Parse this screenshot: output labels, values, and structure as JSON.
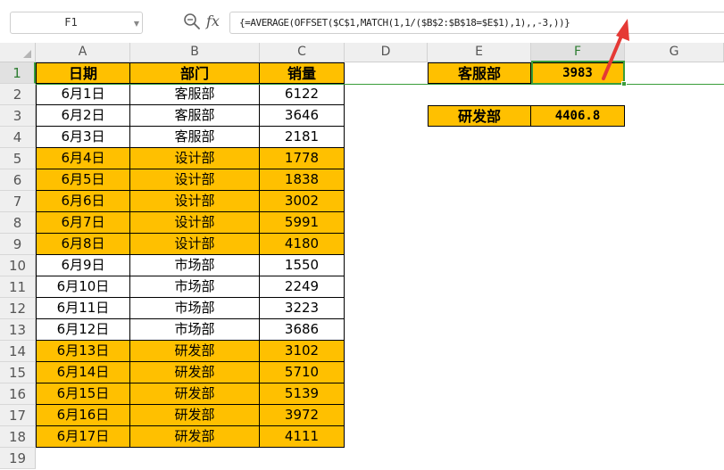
{
  "formula_bar": {
    "name_box": "F1",
    "formula": "{=AVERAGE(OFFSET($C$1,MATCH(1,1/($B$2:$B$18=$E$1),1),,-3,))}",
    "zoom_icon": "zoom-search-icon",
    "fx_label": "fx"
  },
  "columns": [
    "A",
    "B",
    "C",
    "D",
    "E",
    "F",
    "G"
  ],
  "active_column": "F",
  "active_row": "1",
  "rows": [
    "1",
    "2",
    "3",
    "4",
    "5",
    "6",
    "7",
    "8",
    "9",
    "10",
    "11",
    "12",
    "13",
    "14",
    "15",
    "16",
    "17",
    "18",
    "19"
  ],
  "table": {
    "headers": [
      "日期",
      "部门",
      "销量"
    ],
    "data": [
      {
        "date": "6月1日",
        "dept": "客服部",
        "sales": "6122",
        "highlight": false
      },
      {
        "date": "6月2日",
        "dept": "客服部",
        "sales": "3646",
        "highlight": false
      },
      {
        "date": "6月3日",
        "dept": "客服部",
        "sales": "2181",
        "highlight": false
      },
      {
        "date": "6月4日",
        "dept": "设计部",
        "sales": "1778",
        "highlight": true
      },
      {
        "date": "6月5日",
        "dept": "设计部",
        "sales": "1838",
        "highlight": true
      },
      {
        "date": "6月6日",
        "dept": "设计部",
        "sales": "3002",
        "highlight": true
      },
      {
        "date": "6月7日",
        "dept": "设计部",
        "sales": "5991",
        "highlight": true
      },
      {
        "date": "6月8日",
        "dept": "设计部",
        "sales": "4180",
        "highlight": true
      },
      {
        "date": "6月9日",
        "dept": "市场部",
        "sales": "1550",
        "highlight": false
      },
      {
        "date": "6月10日",
        "dept": "市场部",
        "sales": "2249",
        "highlight": false
      },
      {
        "date": "6月11日",
        "dept": "市场部",
        "sales": "3223",
        "highlight": false
      },
      {
        "date": "6月12日",
        "dept": "市场部",
        "sales": "3686",
        "highlight": false
      },
      {
        "date": "6月13日",
        "dept": "研发部",
        "sales": "3102",
        "highlight": true
      },
      {
        "date": "6月14日",
        "dept": "研发部",
        "sales": "5710",
        "highlight": true
      },
      {
        "date": "6月15日",
        "dept": "研发部",
        "sales": "5139",
        "highlight": true
      },
      {
        "date": "6月16日",
        "dept": "研发部",
        "sales": "3972",
        "highlight": true
      },
      {
        "date": "6月17日",
        "dept": "研发部",
        "sales": "4111",
        "highlight": true
      }
    ]
  },
  "lookup": [
    {
      "label": "客服部",
      "value": "3983"
    },
    {
      "label": "研发部",
      "value": "4406.8"
    }
  ],
  "colors": {
    "orange": "#ffc000",
    "selection_green": "#3a9d3a",
    "annotation_red": "#e53935"
  }
}
